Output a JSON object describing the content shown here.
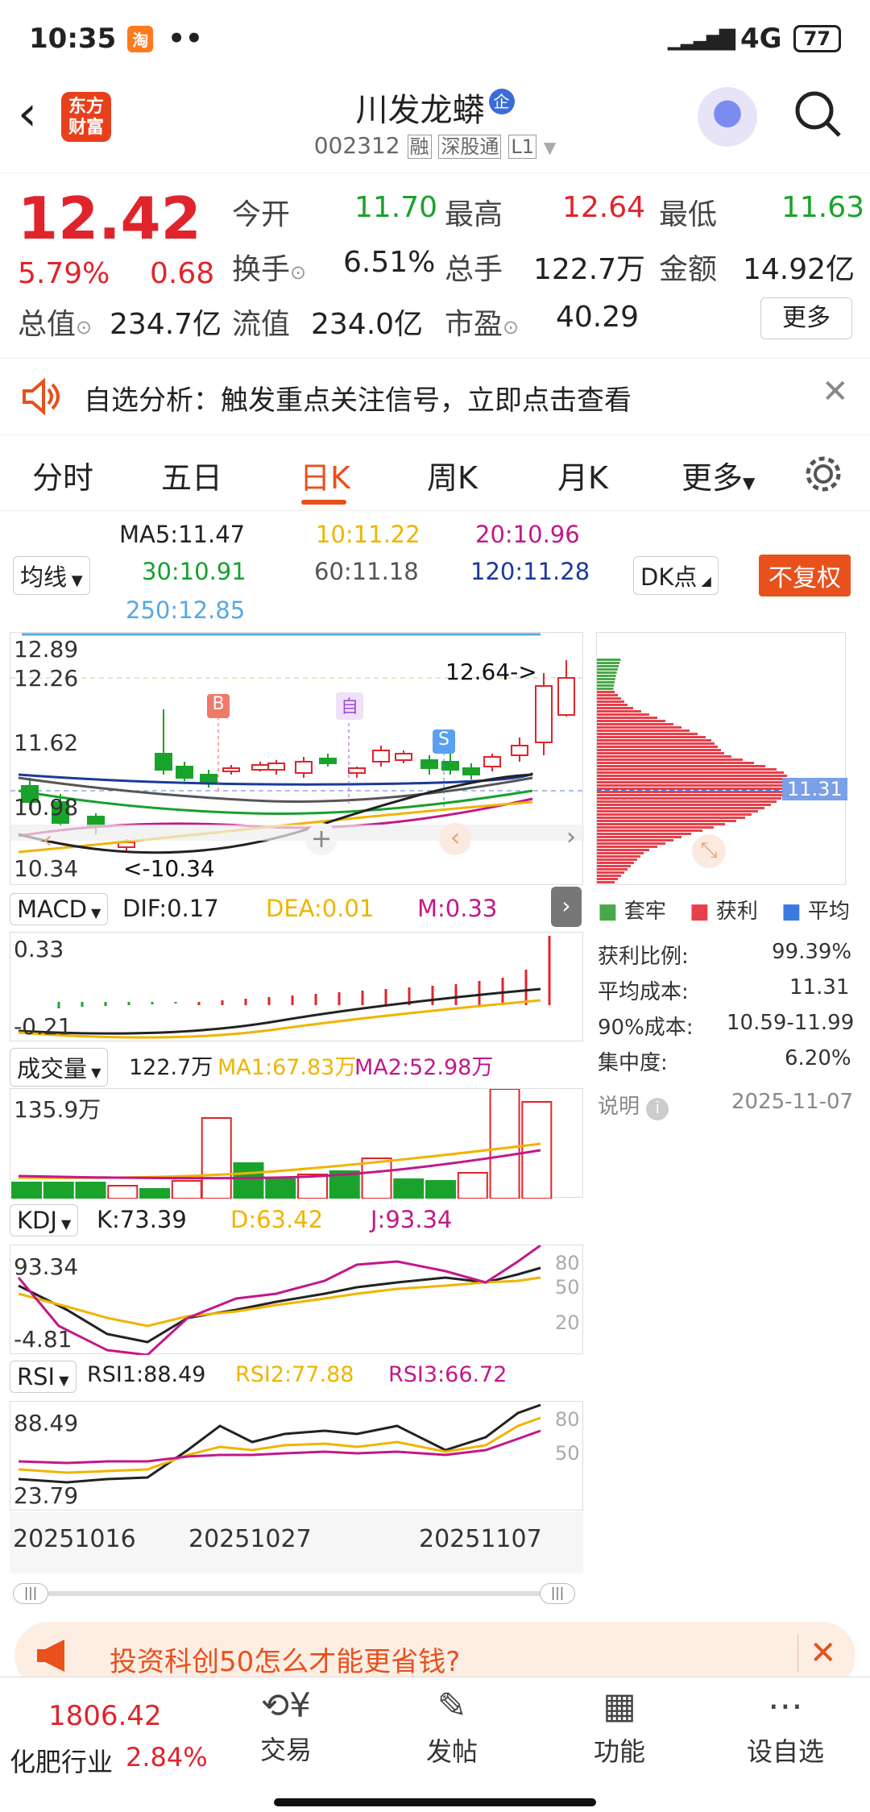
{
  "status": {
    "time": "10:35",
    "network": "4G",
    "battery": "77",
    "app_badge": "淘"
  },
  "header": {
    "title": "川发龙蟒",
    "title_badge": "企",
    "code": "002312",
    "tags": [
      "融",
      "深股通",
      "L1"
    ],
    "logo_text": "东方\n财富"
  },
  "quote": {
    "price": "12.42",
    "change_pct": "5.79%",
    "change": "0.68",
    "fields": [
      {
        "label": "今开",
        "value": "11.70"
      },
      {
        "label": "最高",
        "value": "12.64"
      },
      {
        "label": "最低",
        "value": "11.63"
      },
      {
        "label": "换手",
        "value": "6.51%"
      },
      {
        "label": "总手",
        "value": "122.7万"
      },
      {
        "label": "金额",
        "value": "14.92亿"
      },
      {
        "label": "总值",
        "value": "234.7亿"
      },
      {
        "label": "流值",
        "value": "234.0亿"
      },
      {
        "label": "市盈",
        "value": "40.29"
      }
    ],
    "more": "更多"
  },
  "banner": {
    "text": "自选分析：触发重点关注信号，立即点击查看"
  },
  "tabs": [
    "分时",
    "五日",
    "日K",
    "周K",
    "月K",
    "更多"
  ],
  "active_tab": "日K",
  "ma": {
    "selector": "均线",
    "ma5": "MA5:11.47",
    "ma10": "10:11.22",
    "ma20": "20:10.96",
    "ma30": "30:10.91",
    "ma60": "60:11.18",
    "ma120": "120:11.28",
    "ma250": "250:12.85",
    "dk": "DK点",
    "adjust": "不复权",
    "colors": {
      "ma5": "#222222",
      "ma10": "#f0b400",
      "ma20": "#c2188a",
      "ma30": "#18a030",
      "ma60": "#555555",
      "ma120": "#1a3a9a",
      "ma250": "#58a8e0"
    }
  },
  "kline": {
    "y_labels": [
      "12.89",
      "12.26",
      "11.62",
      "10.98",
      "10.34"
    ],
    "high_label": "12.64->",
    "low_label": "<-10.34",
    "markers": [
      "B",
      "自",
      "S"
    ]
  },
  "macd": {
    "selector": "MACD",
    "dif": "DIF:0.17",
    "dea": "DEA:0.01",
    "m": "M:0.33",
    "y_top": "0.33",
    "y_bottom": "-0.21"
  },
  "volume": {
    "selector": "成交量",
    "vol": "122.7万",
    "ma1": "MA1:67.83万",
    "ma2": "MA2:52.98万",
    "y_top": "135.9万"
  },
  "kdj": {
    "selector": "KDJ",
    "k": "K:73.39",
    "d": "D:63.42",
    "j": "J:93.34",
    "y_top": "93.34",
    "y_bottom": "-4.81",
    "ticks": [
      "80",
      "50",
      "20"
    ]
  },
  "rsi": {
    "selector": "RSI",
    "rsi1": "RSI1:88.49",
    "rsi2": "RSI2:77.88",
    "rsi3": "RSI3:66.72",
    "y_top": "88.49",
    "y_bottom": "23.79",
    "ticks": [
      "80",
      "50"
    ]
  },
  "dates": [
    "20251016",
    "20251027",
    "20251107"
  ],
  "chips": {
    "price_marker": "11.31",
    "legend": [
      "套牢",
      "获利",
      "平均"
    ],
    "stats": [
      {
        "label": "获利比例:",
        "value": "99.39%"
      },
      {
        "label": "平均成本:",
        "value": "11.31"
      },
      {
        "label": "90%成本:",
        "value": "10.59-11.99"
      },
      {
        "label": "集中度:",
        "value": "6.20%"
      }
    ],
    "note": "说明",
    "date": "2025-11-07"
  },
  "ad": {
    "text": "投资科创50怎么才能更省钱?"
  },
  "bottom": {
    "index_value": "1806.42",
    "industry": "化肥行业",
    "industry_pct": "2.84%",
    "items": [
      "交易",
      "发帖",
      "功能",
      "设自选"
    ]
  }
}
